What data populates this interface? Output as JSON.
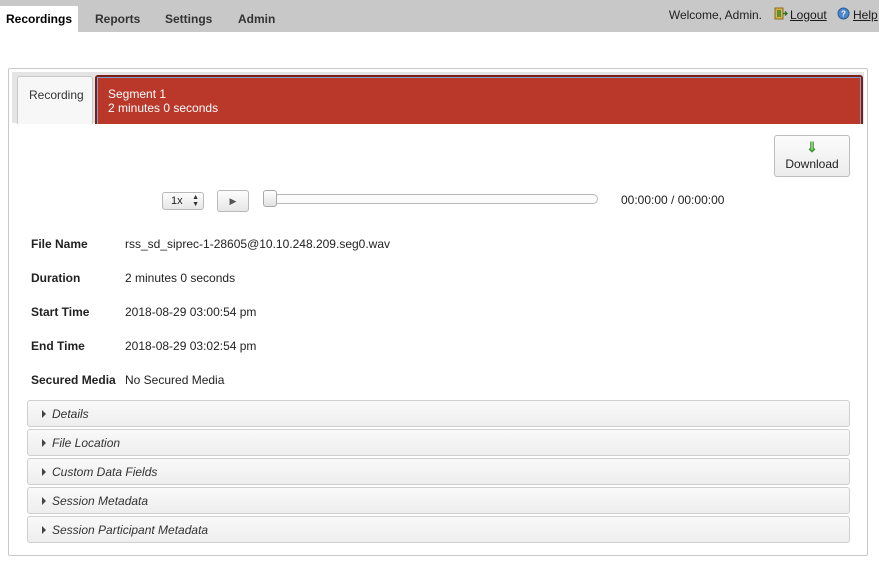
{
  "nav": {
    "tabs": [
      {
        "label": "Recordings",
        "active": true
      },
      {
        "label": "Reports",
        "active": false
      },
      {
        "label": "Settings",
        "active": false
      },
      {
        "label": "Admin",
        "active": false
      }
    ],
    "welcome": "Welcome, Admin.",
    "logout": "Logout",
    "help": "Help",
    "logout_icon": "exit-door-icon",
    "help_icon": "help-circle-icon"
  },
  "tabs": {
    "recording": "Recording",
    "segment_title": "Segment 1",
    "segment_duration": "2 minutes 0 seconds",
    "segment_color": "#b9382a"
  },
  "toolbar": {
    "download": "Download",
    "download_icon": "download-arrow-icon"
  },
  "player": {
    "speed": "1x",
    "play_icon": "play-icon",
    "time": "00:00:00 / 00:00:00",
    "progress": 0
  },
  "details": [
    {
      "label": "File Name",
      "value": "rss_sd_siprec-1-28605@10.10.248.209.seg0.wav"
    },
    {
      "label": "Duration",
      "value": "2 minutes 0 seconds"
    },
    {
      "label": "Start Time",
      "value": "2018-08-29 03:00:54 pm"
    },
    {
      "label": "End Time",
      "value": "2018-08-29 03:02:54 pm"
    },
    {
      "label": "Secured Media",
      "value": "No Secured Media"
    }
  ],
  "sections": [
    {
      "label": "Details"
    },
    {
      "label": "File Location"
    },
    {
      "label": "Custom Data Fields"
    },
    {
      "label": "Session Metadata"
    },
    {
      "label": "Session Participant Metadata"
    }
  ]
}
